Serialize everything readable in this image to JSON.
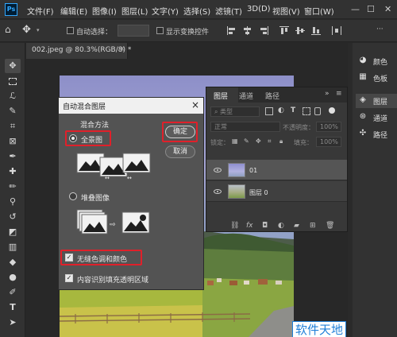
{
  "app": {
    "logo": "Ps"
  },
  "menu": [
    "文件(F)",
    "编辑(E)",
    "图像(I)",
    "图层(L)",
    "文字(Y)",
    "选择(S)",
    "滤镜(T)",
    "3D(D)",
    "视图(V)",
    "窗口(W)"
  ],
  "window_controls": {
    "minimize": "—",
    "maximize": "☐",
    "close": "✕"
  },
  "options": {
    "auto_select_label": "自动选择：",
    "show_transform_label": "显示变换控件",
    "more": "···"
  },
  "document": {
    "tab_label": "002.jpeg @ 80.3%(RGB/8) *",
    "close": "×"
  },
  "dialog": {
    "title": "自动混合图层",
    "close": "×",
    "method_label": "混合方法",
    "option_panorama": "全景图",
    "option_stack": "堆叠图像",
    "seamless_label": "无缝色调和颜色",
    "content_aware_label": "内容识别填充透明区域",
    "ok_label": "确定",
    "cancel_label": "取消"
  },
  "layers_panel": {
    "tabs": [
      "图层",
      "通道",
      "路径"
    ],
    "menu_icon": "≡",
    "collapse_icon": "»",
    "search_placeholder": "类型",
    "blend_mode": "正常",
    "opacity_label": "不透明度：",
    "opacity_value": "100%",
    "lock_label": "锁定：",
    "fill_label": "填充：",
    "fill_value": "100%",
    "layers": [
      {
        "name": "01"
      },
      {
        "name": "图层 0"
      }
    ]
  },
  "dock": {
    "items": [
      {
        "label": "颜色",
        "icon": "palette-icon"
      },
      {
        "label": "色板",
        "icon": "swatches-icon"
      },
      {
        "label": "图层",
        "icon": "layers-icon"
      },
      {
        "label": "通道",
        "icon": "channels-icon"
      },
      {
        "label": "路径",
        "icon": "paths-icon"
      }
    ]
  },
  "watermark": "软件天地",
  "colors": {
    "accent_red": "#e0202a",
    "watermark_blue": "#1f7fd8"
  }
}
